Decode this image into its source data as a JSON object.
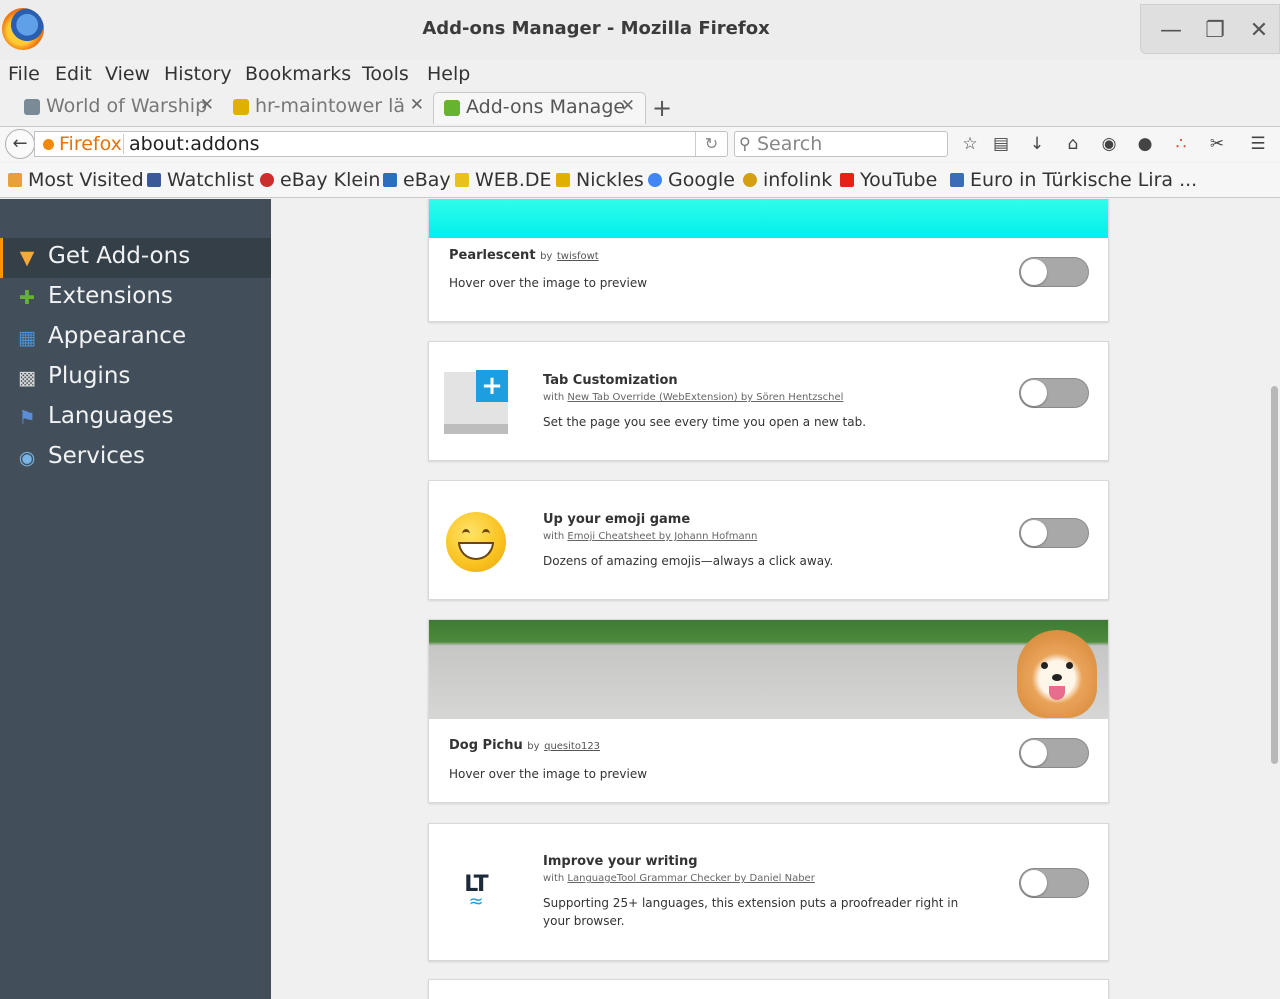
{
  "window": {
    "title": "Add-ons Manager - Mozilla Firefox"
  },
  "menu": [
    "File",
    "Edit",
    "View",
    "History",
    "Bookmarks",
    "Tools",
    "Help"
  ],
  "tabs": [
    {
      "label": "World of Warship",
      "icon": "warship-shield-icon",
      "color": "#7a8a96",
      "active": false
    },
    {
      "label": "hr-maintower lä",
      "icon": "nickles-n-icon",
      "color": "#e0b000",
      "active": false
    },
    {
      "label": "Add-ons Manage",
      "icon": "puzzle-icon",
      "color": "#65b32e",
      "active": true
    }
  ],
  "navbar": {
    "identity_label": "Firefox",
    "url": "about:addons",
    "search_placeholder": "Search"
  },
  "bookmarks": [
    {
      "label": "Most Visited",
      "color": "#e8a03a"
    },
    {
      "label": "Watchlist",
      "color": "#3b5998"
    },
    {
      "label": "eBay Klein",
      "color": "#cc2d2d"
    },
    {
      "label": "eBay",
      "color": "#2c6fbf"
    },
    {
      "label": "WEB.DE",
      "color": "#e8c21a"
    },
    {
      "label": "Nickles",
      "color": "#e0b000"
    },
    {
      "label": "Google",
      "color": "#4285f4"
    },
    {
      "label": "infolink",
      "color": "#d4a010"
    },
    {
      "label": "YouTube",
      "color": "#e62117"
    },
    {
      "label": "Euro in Türkische Lira ...",
      "color": "#3a6db5"
    }
  ],
  "sidebar": {
    "items": [
      {
        "label": "Get Add-ons",
        "icon": "get-addons-icon",
        "color": "#f4a93a",
        "selected": true
      },
      {
        "label": "Extensions",
        "icon": "puzzle-icon",
        "color": "#65b32e",
        "selected": false
      },
      {
        "label": "Appearance",
        "icon": "appearance-icon",
        "color": "#4a90d9",
        "selected": false
      },
      {
        "label": "Plugins",
        "icon": "plugin-icon",
        "color": "#d8d8d8",
        "selected": false
      },
      {
        "label": "Languages",
        "icon": "language-flag-icon",
        "color": "#5b8ed6",
        "selected": false
      },
      {
        "label": "Services",
        "icon": "speech-bubble-icon",
        "color": "#78b4e6",
        "selected": false
      }
    ]
  },
  "cards": {
    "pearlescent": {
      "title": "Pearlescent",
      "by": "by",
      "author": "twisfowt",
      "desc": "Hover over the image to preview",
      "enabled": false
    },
    "tab_customization": {
      "title": "Tab Customization",
      "with": "with",
      "extension": "New Tab Override (WebExtension) by Sören Hentzschel",
      "desc": "Set the page you see every time you open a new tab.",
      "enabled": false
    },
    "emoji": {
      "title": "Up your emoji game",
      "with": "with",
      "extension": "Emoji Cheatsheet by Johann Hofmann",
      "desc": "Dozens of amazing emojis—always a click away.",
      "enabled": false
    },
    "dog_pichu": {
      "title": "Dog Pichu",
      "by": "by",
      "author": "quesito123",
      "desc": "Hover over the image to preview",
      "enabled": false
    },
    "writing": {
      "title": "Improve your writing",
      "with": "with",
      "extension": "LanguageTool Grammar Checker by Daniel Naber",
      "desc": "Supporting 25+ languages, this extension puts a proofreader right in your browser.",
      "logo_text": "LT",
      "enabled": false
    }
  },
  "colors": {
    "sidebar_bg": "#424f5a",
    "accent": "#ff9500",
    "pearlescent_theme": "#19ffea"
  }
}
